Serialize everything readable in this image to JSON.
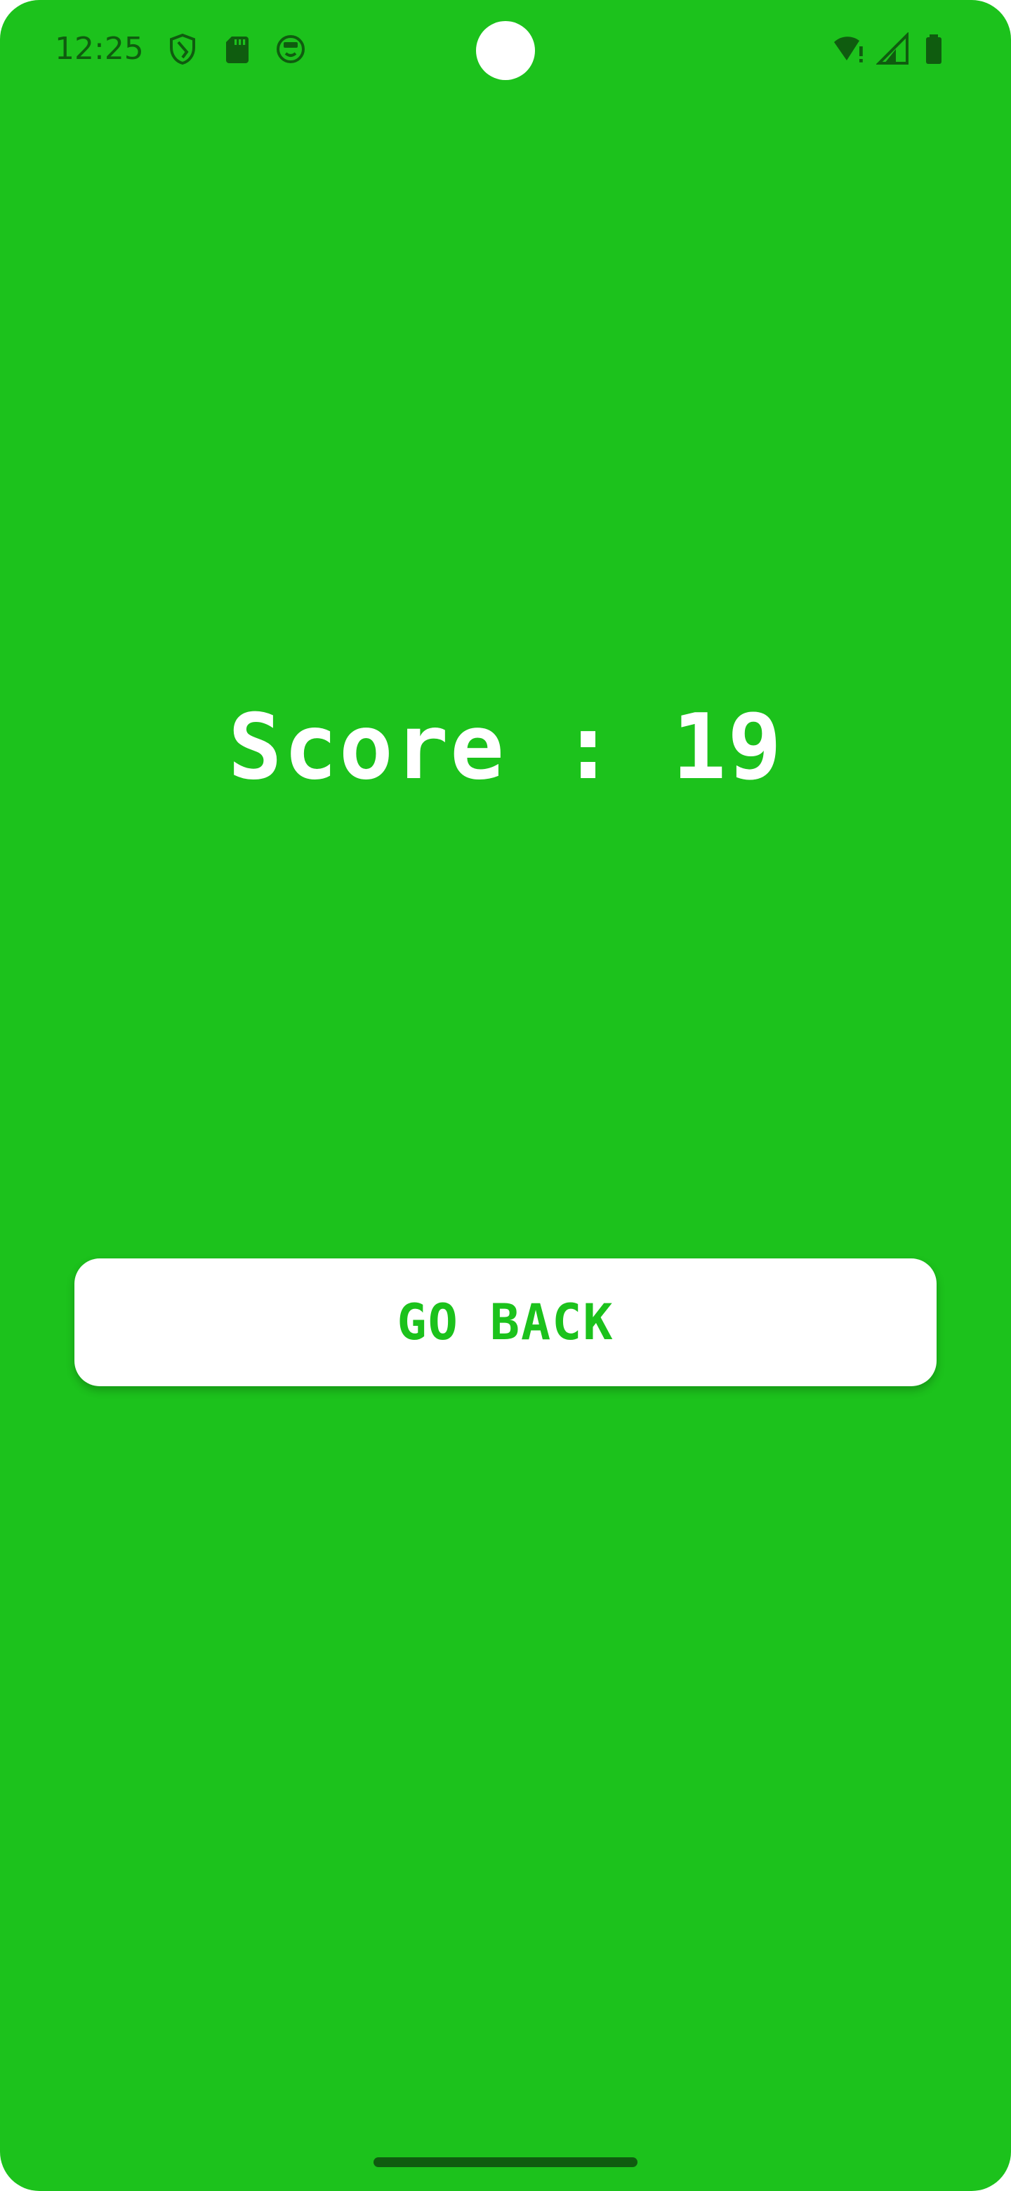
{
  "status_bar": {
    "time": "12:25",
    "icons": [
      "shield-icon",
      "sd-card-icon",
      "face-icon",
      "wifi-alert-icon",
      "cell-signal-icon",
      "battery-icon"
    ],
    "icon_color": "#0f5c0f"
  },
  "main": {
    "score_text": "Score : 19",
    "go_back_label": "GO BACK"
  },
  "colors": {
    "background": "#1cc21c",
    "button_background": "#ffffff",
    "button_text": "#1cc21c",
    "score_text": "#ffffff"
  }
}
